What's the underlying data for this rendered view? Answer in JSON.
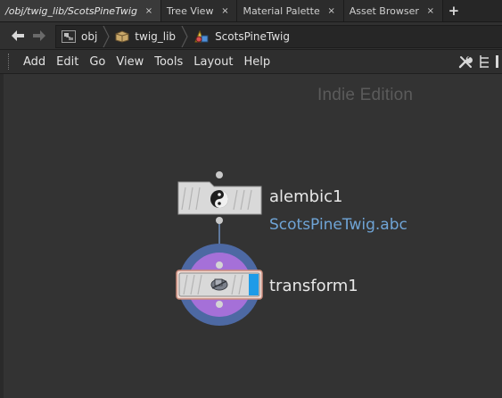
{
  "tabs": [
    {
      "label": "/obj/twig_lib/ScotsPineTwig",
      "close": "×",
      "active": true
    },
    {
      "label": "Tree View",
      "close": "×",
      "active": false
    },
    {
      "label": "Material Palette",
      "close": "×",
      "active": false
    },
    {
      "label": "Asset Browser",
      "close": "×",
      "active": false
    }
  ],
  "add_tab": "+",
  "path": {
    "crumbs": [
      {
        "label": "obj",
        "icon": "obj-network-icon"
      },
      {
        "label": "twig_lib",
        "icon": "geo-box-icon"
      },
      {
        "label": "ScotsPineTwig",
        "icon": "shapes-icon"
      }
    ]
  },
  "menu": {
    "items": [
      "Add",
      "Edit",
      "Go",
      "View",
      "Tools",
      "Layout",
      "Help"
    ],
    "right_icons": [
      "wrench-icon",
      "tree-list-icon",
      "more-icon"
    ]
  },
  "canvas": {
    "edition_label": "Indie Edition",
    "nodes": [
      {
        "name": "alembic1",
        "subtitle": "ScotsPineTwig.abc",
        "icon": "alembic-icon",
        "display_flag": false
      },
      {
        "name": "transform1",
        "subtitle": "",
        "icon": "transform-icon",
        "display_flag": true
      }
    ]
  },
  "colors": {
    "display_flag": "#1e9be8",
    "selection_ring": "#4a6fa8",
    "template_ring": "#9a6ad0",
    "node_body": "#d9d9d9",
    "subtitle": "#6fa4d6"
  }
}
